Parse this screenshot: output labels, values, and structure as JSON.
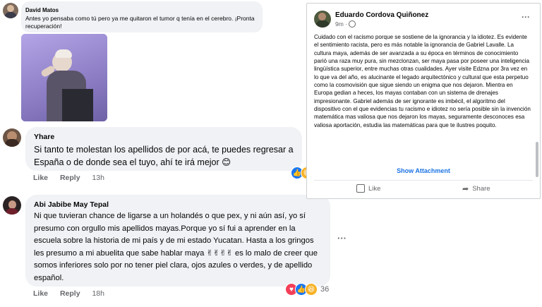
{
  "comment1": {
    "name": "David Matos",
    "text": "Antes yo pensaba como tú pero ya me quitaron el tumor q tenía en el cerebro. ¡Pronta recuperación!"
  },
  "comment2": {
    "name": "Yhare",
    "text": "Si tanto te molestan los apellidos de por acá, te puedes regresar a España o de donde sea el tuyo, ahí te irá mejor 😊",
    "like": "Like",
    "reply": "Reply",
    "time": "13h"
  },
  "comment3": {
    "name": "Abi Jabibe May Tepal",
    "text": "Ni que tuvieran chance de ligarse a un holandés o que pex, y ni aún así, yo sí presumo con orgullo mis apellidos mayas.Porque yo sí fui a aprender en la escuela sobre la historia de mi país y de mi estado Yucatan. Hasta a los gringos les presumo a mi abuelita que sabe hablar maya ✌✌✌✌ es lo malo de creer que somos inferiores solo por no tener piel clara, ojos azules o verdes, y de apellido español.",
    "like": "Like",
    "reply": "Reply",
    "time": "18h",
    "reaction_count": "36",
    "more": "···"
  },
  "post": {
    "author": "Eduardo Cordova Quiñonez",
    "time": "9m · ",
    "menu": "···",
    "body": "Cuidado con el racismo porque se sostiene de la ignorancia y la idiotez. Es evidente el sentimiento racista, pero es más notable la ignorancia de Gabriel Lavalle. La cultura maya, además de ser avanzada a su época en términos de conocimiento parió una raza muy pura, sin mezclonzan, ser maya pasa por poseer una inteligencia lingüística superior, entre muchas otras cualidades. Ayer visite Edzna por 3ra vez en lo que va del año, es alucinante el legado arquitectónico y cultural que esta perpetuo como la cosmovisión que sigue siendo un enigma que nos dejaron. Mientra en Europa gedian a heces, los mayas contaban con un sistema de drenajes impresionante. Gabriel además de ser ignorante es imbécil, el algoritmo del dispositivo con el que evidencias tu racismo e idiotez no sería posible sin la invención matemática mas valiosa que nos dejaron los mayas, seguramente desconoces esa valiosa aportación, estudia las matemáticas para que te ilustres poquito.",
    "show_attachment": "Show Attachment",
    "like": "Like",
    "share": "Share"
  }
}
